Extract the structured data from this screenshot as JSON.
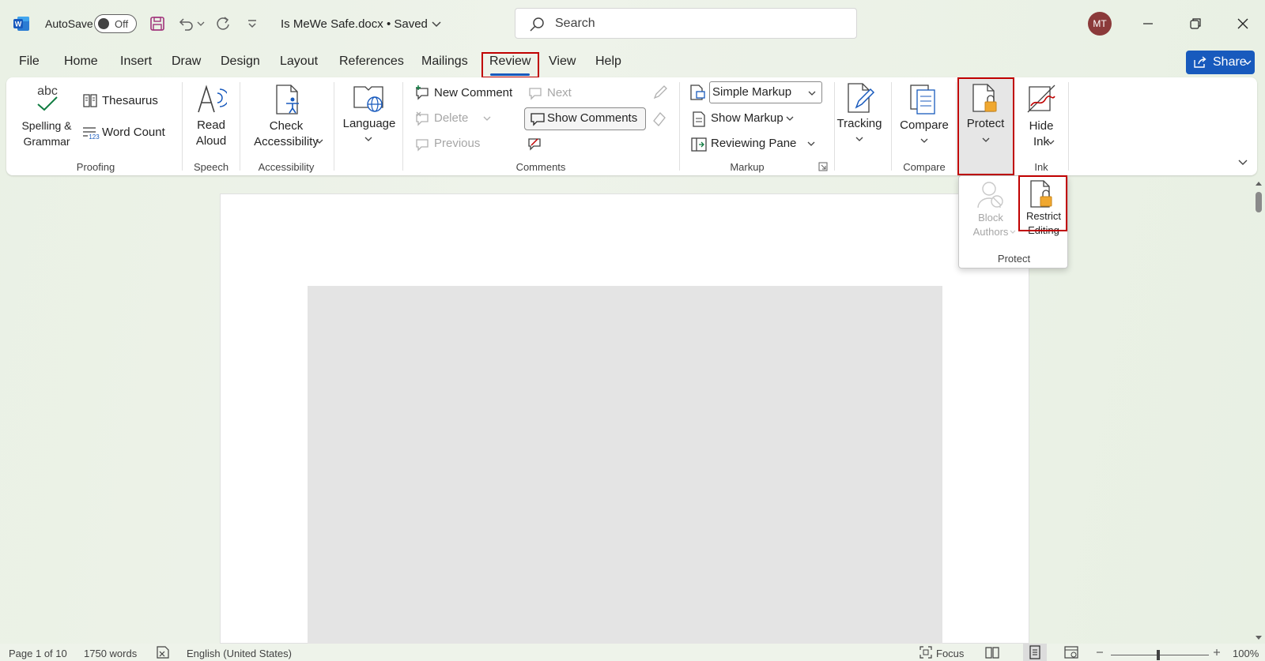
{
  "titlebar": {
    "autosave_label": "AutoSave",
    "autosave_state": "Off",
    "document_title": "Is MeWe Safe.docx • Saved",
    "search_placeholder": "Search",
    "avatar_initials": "MT"
  },
  "tabs": [
    "File",
    "Home",
    "Insert",
    "Draw",
    "Design",
    "Layout",
    "References",
    "Mailings",
    "Review",
    "View",
    "Help"
  ],
  "active_tab": "Review",
  "share_label": "Share",
  "ribbon": {
    "proofing": {
      "spelling_line1": "Spelling &",
      "spelling_line2": "Grammar",
      "spelling_icon_text": "abc",
      "thesaurus": "Thesaurus",
      "word_count": "Word Count",
      "label": "Proofing"
    },
    "speech": {
      "read_line1": "Read",
      "read_line2": "Aloud",
      "label": "Speech"
    },
    "accessibility": {
      "check_line1": "Check",
      "check_line2": "Accessibility",
      "label": "Accessibility"
    },
    "language": {
      "label_btn": "Language"
    },
    "comments": {
      "new_comment": "New Comment",
      "delete": "Delete",
      "previous": "Previous",
      "next": "Next",
      "show_comments": "Show Comments",
      "label": "Comments"
    },
    "markup": {
      "display_mode": "Simple Markup",
      "show_markup": "Show Markup",
      "reviewing_pane": "Reviewing Pane",
      "label": "Markup"
    },
    "tracking": {
      "label_btn": "Tracking"
    },
    "compare": {
      "label_btn": "Compare",
      "label": "Compare"
    },
    "protect": {
      "label_btn": "Protect"
    },
    "ink": {
      "hide_line1": "Hide",
      "hide_line2": "Ink",
      "label": "Ink"
    }
  },
  "protect_dropdown": {
    "block_line1": "Block",
    "block_line2": "Authors",
    "restrict_line1": "Restrict",
    "restrict_line2": "Editing",
    "label": "Protect"
  },
  "statusbar": {
    "page": "Page 1 of 10",
    "words": "1750 words",
    "language": "English (United States)",
    "focus": "Focus",
    "zoom": "100%"
  },
  "colors": {
    "accent": "#185abd",
    "highlight": "#c00000",
    "lock": "#f0a830"
  }
}
